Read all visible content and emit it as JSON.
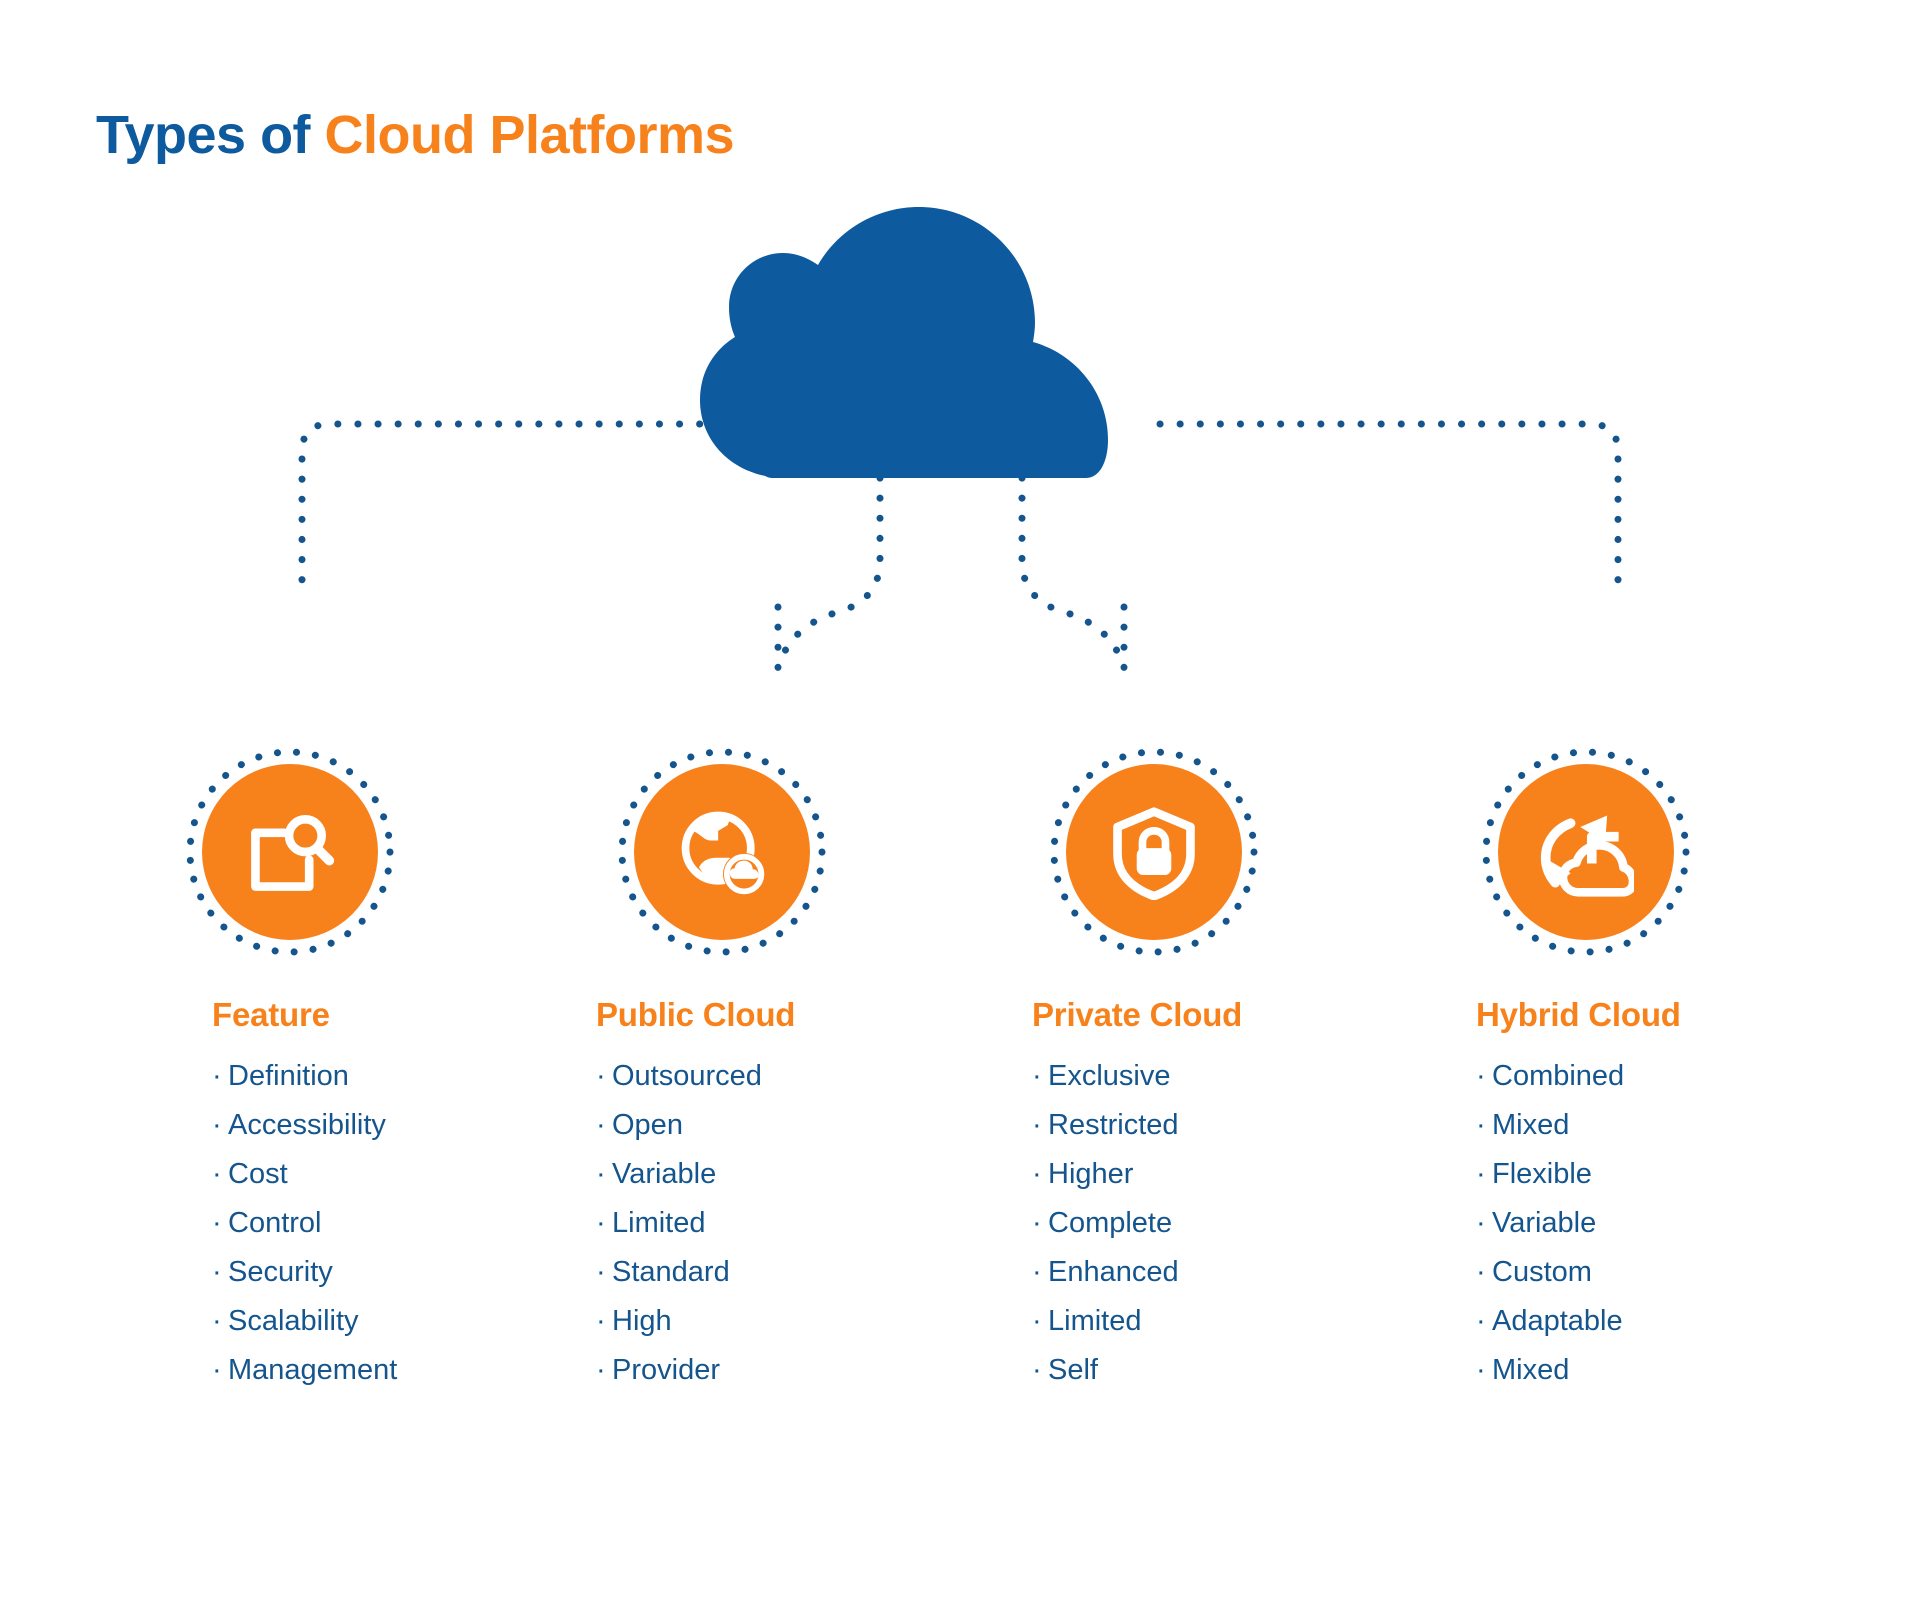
{
  "title": {
    "part1": "Types of ",
    "part2": "Cloud Platforms"
  },
  "colors": {
    "brand_blue": "#0d5a9e",
    "text_blue": "#15558d",
    "accent_orange": "#f7811b",
    "background": "#ffffff"
  },
  "central_node": {
    "icon": "cloud-icon",
    "color": "#0d5a9e"
  },
  "nodes": [
    {
      "icon": "document-search-icon",
      "label": "Feature"
    },
    {
      "icon": "globe-cloud-icon",
      "label": "Public Cloud"
    },
    {
      "icon": "shield-lock-icon",
      "label": "Private Cloud"
    },
    {
      "icon": "cloud-sync-icon",
      "label": "Hybrid Cloud"
    }
  ],
  "columns": [
    {
      "header": "Feature",
      "bullet": "·",
      "items": [
        "Definition",
        "Accessibility",
        "Cost",
        "Control",
        "Security",
        "Scalability",
        "Management"
      ]
    },
    {
      "header": "Public Cloud",
      "bullet": "·",
      "items": [
        "Outsourced",
        "Open",
        "Variable",
        "Limited",
        "Standard",
        "High",
        "Provider"
      ]
    },
    {
      "header": "Private Cloud",
      "bullet": "·",
      "items": [
        "Exclusive",
        "Restricted",
        "Higher",
        "Complete",
        "Enhanced",
        "Limited",
        "Self"
      ]
    },
    {
      "header": "Hybrid Cloud",
      "bullet": "·",
      "items": [
        "Combined",
        "Mixed",
        "Flexible",
        "Variable",
        "Custom",
        "Adaptable",
        "Mixed"
      ]
    }
  ]
}
